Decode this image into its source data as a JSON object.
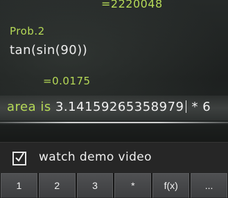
{
  "board": {
    "result1": "=2220048",
    "problem_title": "Prob.2",
    "expression": "tan(sin(90))",
    "result2": "=0.0175",
    "input": {
      "label": "area is",
      "value": "3.14159265358979",
      "rest": "* 6"
    }
  },
  "options": {
    "demo_checked": true,
    "demo_label": "watch demo video"
  },
  "keypad": {
    "keys": [
      "1",
      "2",
      "3",
      "*",
      "f(x)",
      "..."
    ]
  },
  "colors": {
    "chalk_green": "#b6da57",
    "chalk_white": "#ededed",
    "board": "#1f2221"
  }
}
